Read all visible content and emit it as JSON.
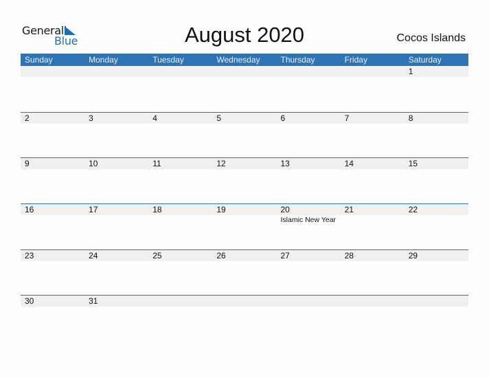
{
  "logo": {
    "line1": "General",
    "line2": "Blue",
    "accent": "#1f6fb8"
  },
  "title": "August 2020",
  "country": "Cocos Islands",
  "colors": {
    "header_bg": "#2e74b5",
    "date_band": "#f0f0f0"
  },
  "weekdays": [
    "Sunday",
    "Monday",
    "Tuesday",
    "Wednesday",
    "Thursday",
    "Friday",
    "Saturday"
  ],
  "weeks": [
    [
      {
        "d": ""
      },
      {
        "d": ""
      },
      {
        "d": ""
      },
      {
        "d": ""
      },
      {
        "d": ""
      },
      {
        "d": ""
      },
      {
        "d": "1"
      }
    ],
    [
      {
        "d": "2"
      },
      {
        "d": "3"
      },
      {
        "d": "4"
      },
      {
        "d": "5"
      },
      {
        "d": "6"
      },
      {
        "d": "7"
      },
      {
        "d": "8"
      }
    ],
    [
      {
        "d": "9"
      },
      {
        "d": "10"
      },
      {
        "d": "11"
      },
      {
        "d": "12"
      },
      {
        "d": "13"
      },
      {
        "d": "14"
      },
      {
        "d": "15"
      }
    ],
    [
      {
        "d": "16"
      },
      {
        "d": "17"
      },
      {
        "d": "18"
      },
      {
        "d": "19"
      },
      {
        "d": "20",
        "event": "Islamic New Year"
      },
      {
        "d": "21"
      },
      {
        "d": "22"
      }
    ],
    [
      {
        "d": "23"
      },
      {
        "d": "24"
      },
      {
        "d": "25"
      },
      {
        "d": "26"
      },
      {
        "d": "27"
      },
      {
        "d": "28"
      },
      {
        "d": "29"
      }
    ],
    [
      {
        "d": "30"
      },
      {
        "d": "31"
      },
      {
        "d": ""
      },
      {
        "d": ""
      },
      {
        "d": ""
      },
      {
        "d": ""
      },
      {
        "d": ""
      }
    ]
  ]
}
